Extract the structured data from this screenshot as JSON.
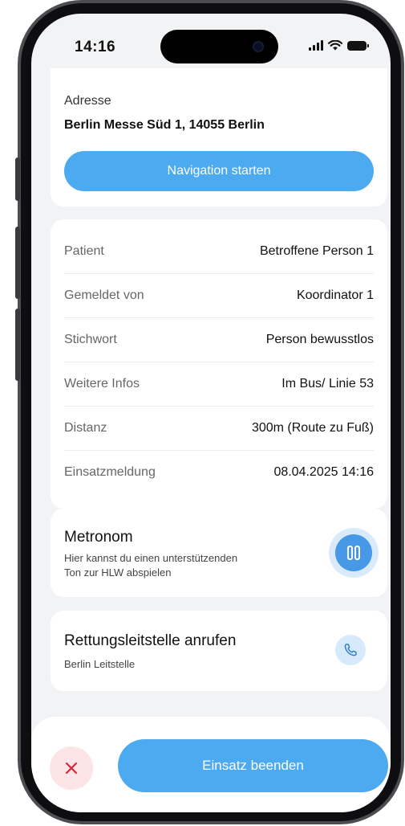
{
  "status_bar": {
    "time": "14:16"
  },
  "address": {
    "label": "Adresse",
    "value": "Berlin Messe Süd 1, 14055 Berlin",
    "nav_button_label": "Navigation starten"
  },
  "details": [
    {
      "label": "Patient",
      "value": "Betroffene Person 1"
    },
    {
      "label": "Gemeldet von",
      "value": "Koordinator 1"
    },
    {
      "label": "Stichwort",
      "value": "Person bewusstlos"
    },
    {
      "label": "Weitere Infos",
      "value": "Im Bus/ Linie 53"
    },
    {
      "label": "Distanz",
      "value": "300m (Route zu Fuß)"
    },
    {
      "label": "Einsatzmeldung",
      "value": "08.04.2025 14:16"
    }
  ],
  "metronom": {
    "title": "Metronom",
    "subtitle_line1": "Hier kannst du einen unterstützenden",
    "subtitle_line2": "Ton zur HLW abspielen",
    "control_icon": "pause-icon"
  },
  "call": {
    "title": "Rettungsleitstelle anrufen",
    "subtitle": "Berlin Leitstelle",
    "icon": "phone-icon"
  },
  "footer": {
    "cancel_icon": "close-icon",
    "end_button_label": "Einsatz beenden"
  },
  "colors": {
    "accent": "#4BAAF0",
    "accent_dark": "#4798E6",
    "danger": "#E0263A",
    "background": "#F2F3F4"
  }
}
